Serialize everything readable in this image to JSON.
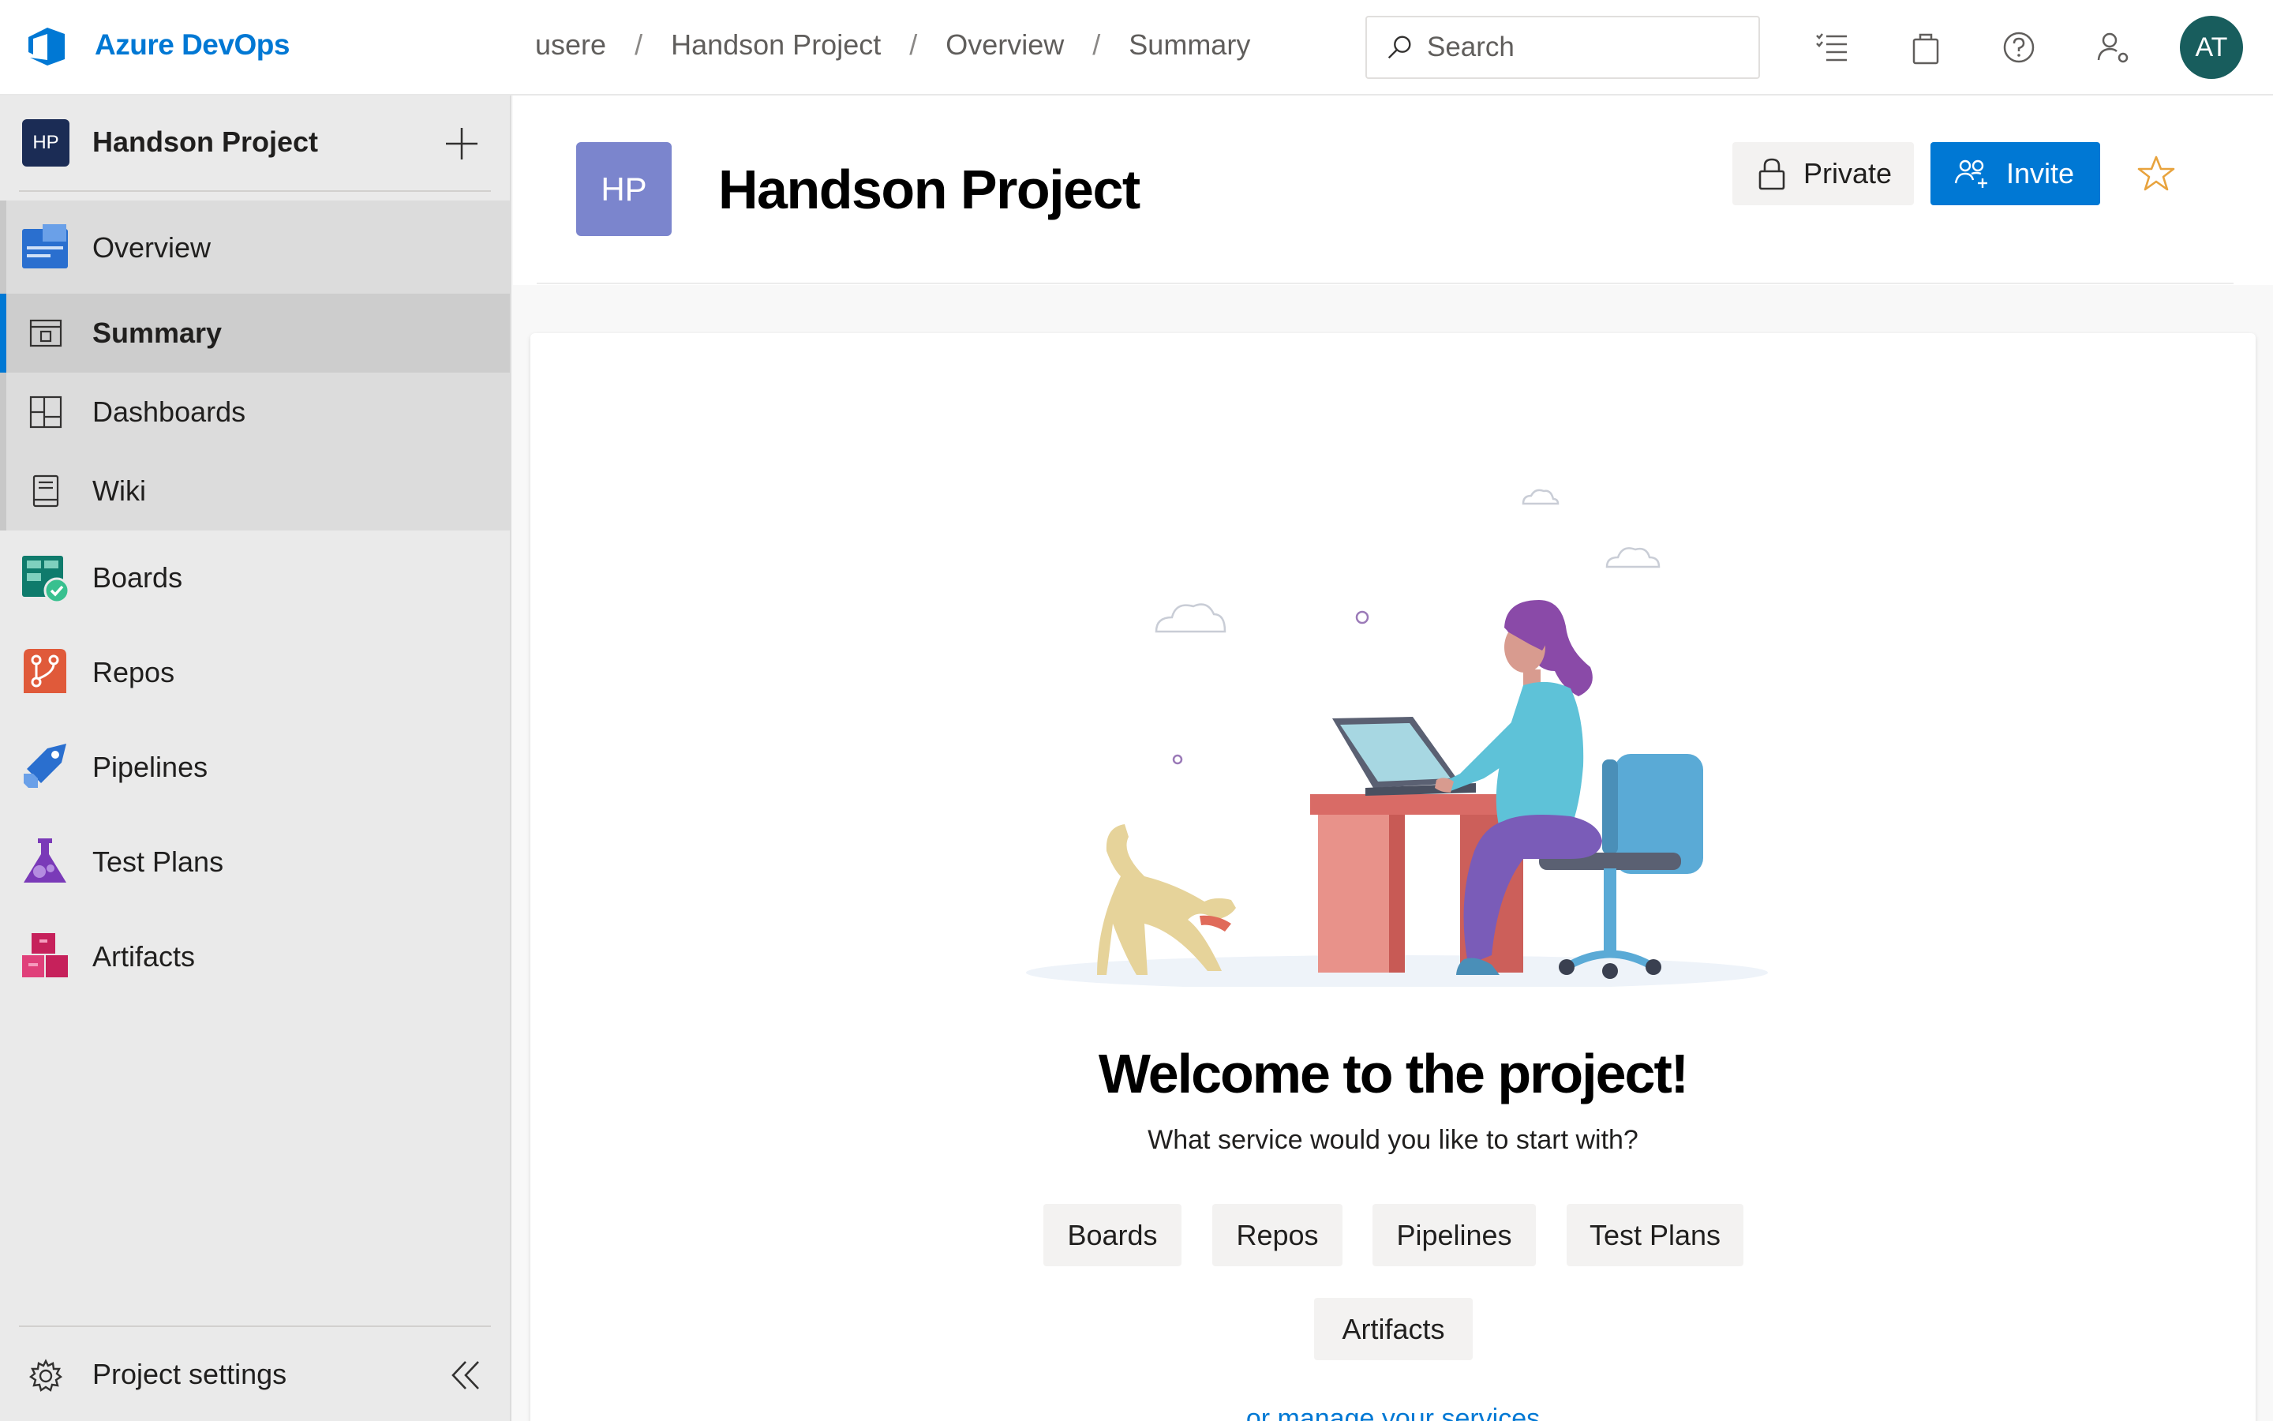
{
  "header": {
    "brand": "Azure DevOps",
    "breadcrumbs": [
      "usere",
      "Handson Project",
      "Overview",
      "Summary"
    ],
    "search_placeholder": "Search",
    "avatar_initials": "AT",
    "icons": [
      "work-items-icon",
      "marketplace-bag-icon",
      "help-icon",
      "user-settings-icon"
    ]
  },
  "sidebar": {
    "project_badge": "HP",
    "project_name": "Handson Project",
    "overview": "Overview",
    "sub_items": [
      {
        "label": "Summary",
        "icon": "summary-icon",
        "selected": true
      },
      {
        "label": "Dashboards",
        "icon": "dashboards-icon",
        "selected": false
      },
      {
        "label": "Wiki",
        "icon": "wiki-icon",
        "selected": false
      }
    ],
    "items": [
      {
        "label": "Boards",
        "icon": "boards-icon"
      },
      {
        "label": "Repos",
        "icon": "repos-icon"
      },
      {
        "label": "Pipelines",
        "icon": "pipelines-icon"
      },
      {
        "label": "Test Plans",
        "icon": "test-plans-icon"
      },
      {
        "label": "Artifacts",
        "icon": "artifacts-icon"
      }
    ],
    "settings": "Project settings"
  },
  "main": {
    "tile": "HP",
    "title": "Handson Project",
    "private_label": "Private",
    "invite_label": "Invite",
    "welcome": "Welcome to the project!",
    "subtitle": "What service would you like to start with?",
    "services": [
      "Boards",
      "Repos",
      "Pipelines",
      "Test Plans",
      "Artifacts"
    ],
    "manage_link": "or manage your services"
  },
  "colors": {
    "accent": "#0078d4",
    "avatar": "#185d5d",
    "project_tile": "#7b85cd",
    "sidebar_bg": "#eaeaea",
    "star": "#e8a33d"
  }
}
